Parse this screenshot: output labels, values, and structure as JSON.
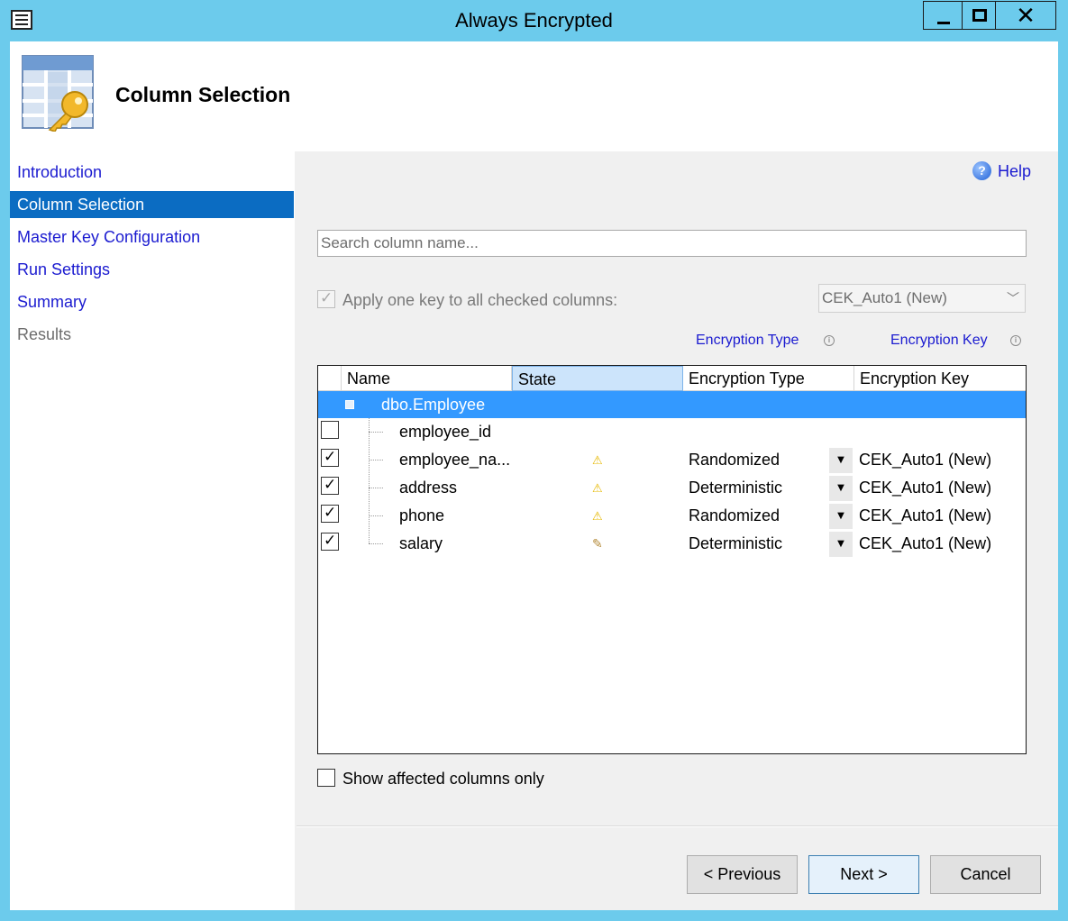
{
  "window": {
    "title": "Always Encrypted",
    "close_glyph": "✕"
  },
  "header": {
    "title": "Column Selection",
    "icon": "table-key-icon"
  },
  "nav": {
    "items": [
      {
        "label": "Introduction",
        "state": "link"
      },
      {
        "label": "Column Selection",
        "state": "active"
      },
      {
        "label": "Master Key Configuration",
        "state": "link"
      },
      {
        "label": "Run Settings",
        "state": "link"
      },
      {
        "label": "Summary",
        "state": "link"
      },
      {
        "label": "Results",
        "state": "disabled"
      }
    ]
  },
  "help": {
    "label": "Help",
    "icon_glyph": "?"
  },
  "search": {
    "placeholder": "Search column name...",
    "value": ""
  },
  "apply_all": {
    "label": "Apply one key to all checked columns:",
    "checked": true,
    "enabled": false,
    "key_value": "CEK_Auto1 (New)"
  },
  "column_headers_links": {
    "encryption_type": "Encryption Type",
    "encryption_key": "Encryption Key",
    "info_glyph": "i"
  },
  "grid": {
    "columns": [
      "Name",
      "State",
      "Encryption Type",
      "Encryption Key"
    ],
    "table": {
      "name": "dbo.Employee"
    },
    "rows": [
      {
        "name": "employee_id",
        "checked": false,
        "state": "",
        "type": "",
        "key": ""
      },
      {
        "name": "employee_na...",
        "checked": true,
        "state": "warning",
        "type": "Randomized",
        "key": "CEK_Auto1 (New)"
      },
      {
        "name": "address",
        "checked": true,
        "state": "warning",
        "type": "Deterministic",
        "key": "CEK_Auto1 (New)"
      },
      {
        "name": "phone",
        "checked": true,
        "state": "warning",
        "type": "Randomized",
        "key": "CEK_Auto1 (New)"
      },
      {
        "name": "salary",
        "checked": true,
        "state": "pencil",
        "type": "Deterministic",
        "key": "CEK_Auto1 (New)"
      }
    ]
  },
  "show_affected": {
    "label": "Show affected columns only",
    "checked": false
  },
  "buttons": {
    "previous": "< Previous",
    "next": "Next >",
    "cancel": "Cancel"
  },
  "colors": {
    "title_bar": "#6ccbec",
    "nav_active": "#0b6cc2",
    "link": "#1b1bd0",
    "grid_selection": "#3399ff"
  }
}
